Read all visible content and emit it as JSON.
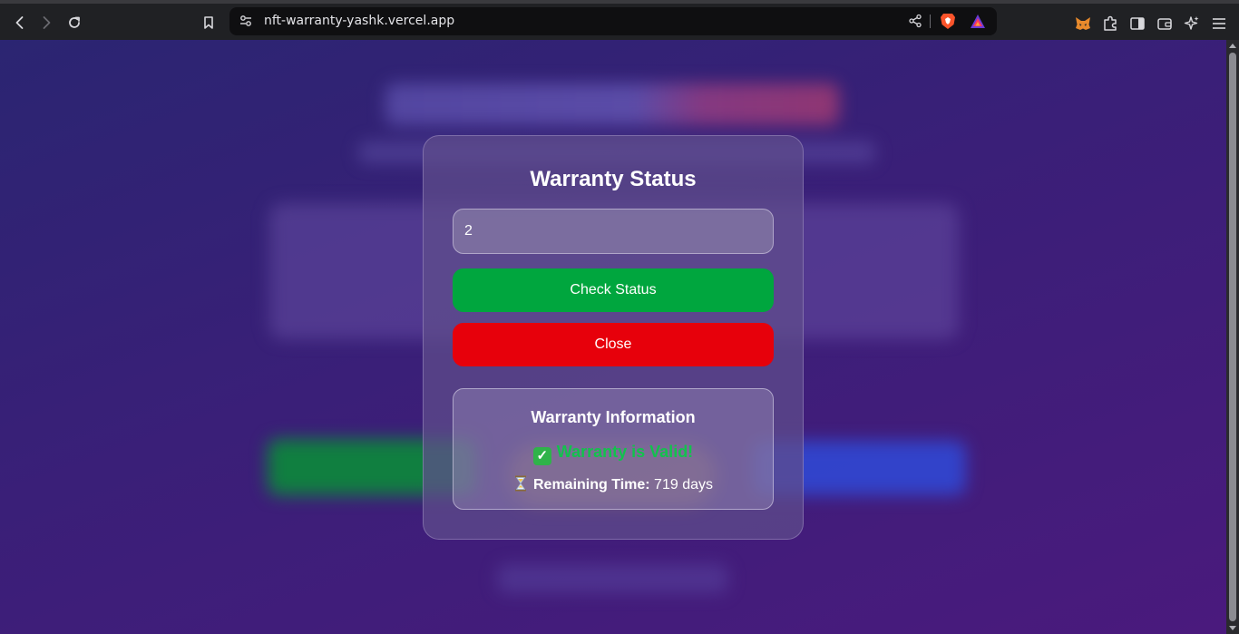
{
  "browser": {
    "url": "nft-warranty-yashk.vercel.app",
    "icons": [
      "back-icon",
      "forward-icon",
      "reload-icon",
      "bookmark-icon",
      "site-settings-icon",
      "share-icon",
      "brave-shields-icon",
      "brave-rewards-icon",
      "metamask-icon",
      "extensions-icon",
      "sidebar-icon",
      "wallet-icon",
      "leo-ai-icon",
      "menu-icon"
    ]
  },
  "modal": {
    "title": "Warranty Status",
    "token_input": {
      "value": "2",
      "placeholder": ""
    },
    "check_button": "Check Status",
    "close_button": "Close",
    "info": {
      "title": "Warranty Information",
      "valid_icon": "✓",
      "valid_text": "Warranty is Valid!",
      "remaining_label": "Remaining Time:",
      "remaining_value": " 719 days"
    }
  },
  "colors": {
    "check_button": "#00a63e",
    "close_button": "#e7000b",
    "valid_text": "#12c24d",
    "page_gradient_start": "#2b2572",
    "page_gradient_end": "#4a1a7d"
  }
}
